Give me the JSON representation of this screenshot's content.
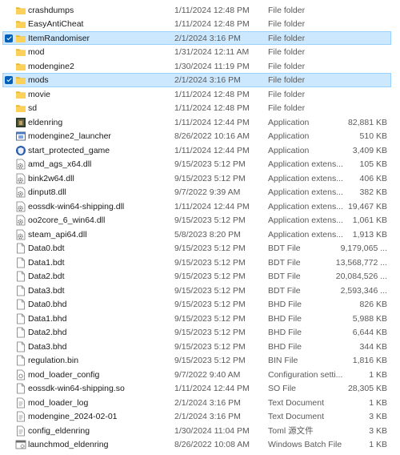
{
  "files": [
    {
      "name": "crashdumps",
      "date": "1/11/2024 12:48 PM",
      "type": "File folder",
      "size": "",
      "icon": "folder-icon",
      "selected": false
    },
    {
      "name": "EasyAntiCheat",
      "date": "1/11/2024 12:48 PM",
      "type": "File folder",
      "size": "",
      "icon": "folder-icon",
      "selected": false
    },
    {
      "name": "ItemRandomiser",
      "date": "2/1/2024 3:16 PM",
      "type": "File folder",
      "size": "",
      "icon": "folder-icon",
      "selected": true
    },
    {
      "name": "mod",
      "date": "1/31/2024 12:11 AM",
      "type": "File folder",
      "size": "",
      "icon": "folder-icon",
      "selected": false
    },
    {
      "name": "modengine2",
      "date": "1/30/2024 11:19 PM",
      "type": "File folder",
      "size": "",
      "icon": "folder-icon",
      "selected": false
    },
    {
      "name": "mods",
      "date": "2/1/2024 3:16 PM",
      "type": "File folder",
      "size": "",
      "icon": "folder-icon",
      "selected": true
    },
    {
      "name": "movie",
      "date": "1/11/2024 12:48 PM",
      "type": "File folder",
      "size": "",
      "icon": "folder-icon",
      "selected": false
    },
    {
      "name": "sd",
      "date": "1/11/2024 12:48 PM",
      "type": "File folder",
      "size": "",
      "icon": "folder-icon",
      "selected": false
    },
    {
      "name": "eldenring",
      "date": "1/11/2024 12:44 PM",
      "type": "Application",
      "size": "82,881 KB",
      "icon": "eldenring-app-icon",
      "selected": false
    },
    {
      "name": "modengine2_launcher",
      "date": "8/26/2022 10:16 AM",
      "type": "Application",
      "size": "510 KB",
      "icon": "application-icon",
      "selected": false
    },
    {
      "name": "start_protected_game",
      "date": "1/11/2024 12:44 PM",
      "type": "Application",
      "size": "3,409 KB",
      "icon": "shield-app-icon",
      "selected": false
    },
    {
      "name": "amd_ags_x64.dll",
      "date": "9/15/2023 5:12 PM",
      "type": "Application extens...",
      "size": "105 KB",
      "icon": "dll-gear-icon",
      "selected": false
    },
    {
      "name": "bink2w64.dll",
      "date": "9/15/2023 5:12 PM",
      "type": "Application extens...",
      "size": "406 KB",
      "icon": "dll-gear-icon",
      "selected": false
    },
    {
      "name": "dinput8.dll",
      "date": "9/7/2022 9:39 AM",
      "type": "Application extens...",
      "size": "382 KB",
      "icon": "dll-gear-icon",
      "selected": false
    },
    {
      "name": "eossdk-win64-shipping.dll",
      "date": "1/11/2024 12:44 PM",
      "type": "Application extens...",
      "size": "19,467 KB",
      "icon": "dll-gear-icon",
      "selected": false
    },
    {
      "name": "oo2core_6_win64.dll",
      "date": "9/15/2023 5:12 PM",
      "type": "Application extens...",
      "size": "1,061 KB",
      "icon": "dll-gear-icon",
      "selected": false
    },
    {
      "name": "steam_api64.dll",
      "date": "5/8/2023 8:20 PM",
      "type": "Application extens...",
      "size": "1,913 KB",
      "icon": "dll-gear-icon",
      "selected": false
    },
    {
      "name": "Data0.bdt",
      "date": "9/15/2023 5:12 PM",
      "type": "BDT File",
      "size": "9,179,065 ...",
      "icon": "file-icon",
      "selected": false
    },
    {
      "name": "Data1.bdt",
      "date": "9/15/2023 5:12 PM",
      "type": "BDT File",
      "size": "13,568,772 ...",
      "icon": "file-icon",
      "selected": false
    },
    {
      "name": "Data2.bdt",
      "date": "9/15/2023 5:12 PM",
      "type": "BDT File",
      "size": "20,084,526 ...",
      "icon": "file-icon",
      "selected": false
    },
    {
      "name": "Data3.bdt",
      "date": "9/15/2023 5:12 PM",
      "type": "BDT File",
      "size": "2,593,346 ...",
      "icon": "file-icon",
      "selected": false
    },
    {
      "name": "Data0.bhd",
      "date": "9/15/2023 5:12 PM",
      "type": "BHD File",
      "size": "826 KB",
      "icon": "file-icon",
      "selected": false
    },
    {
      "name": "Data1.bhd",
      "date": "9/15/2023 5:12 PM",
      "type": "BHD File",
      "size": "5,988 KB",
      "icon": "file-icon",
      "selected": false
    },
    {
      "name": "Data2.bhd",
      "date": "9/15/2023 5:12 PM",
      "type": "BHD File",
      "size": "6,644 KB",
      "icon": "file-icon",
      "selected": false
    },
    {
      "name": "Data3.bhd",
      "date": "9/15/2023 5:12 PM",
      "type": "BHD File",
      "size": "344 KB",
      "icon": "file-icon",
      "selected": false
    },
    {
      "name": "regulation.bin",
      "date": "9/15/2023 5:12 PM",
      "type": "BIN File",
      "size": "1,816 KB",
      "icon": "file-icon",
      "selected": false
    },
    {
      "name": "mod_loader_config",
      "date": "9/7/2022 9:40 AM",
      "type": "Configuration setti...",
      "size": "1 KB",
      "icon": "config-file-icon",
      "selected": false
    },
    {
      "name": "eossdk-win64-shipping.so",
      "date": "1/11/2024 12:44 PM",
      "type": "SO File",
      "size": "28,305 KB",
      "icon": "file-icon",
      "selected": false
    },
    {
      "name": "mod_loader_log",
      "date": "2/1/2024 3:16 PM",
      "type": "Text Document",
      "size": "1 KB",
      "icon": "text-file-icon",
      "selected": false
    },
    {
      "name": "modengine_2024-02-01",
      "date": "2/1/2024 3:16 PM",
      "type": "Text Document",
      "size": "3 KB",
      "icon": "text-file-icon",
      "selected": false
    },
    {
      "name": "config_eldenring",
      "date": "1/30/2024 11:04 PM",
      "type": "Toml 源文件",
      "size": "3 KB",
      "icon": "text-file-icon",
      "selected": false
    },
    {
      "name": "launchmod_eldenring",
      "date": "8/26/2022 10:08 AM",
      "type": "Windows Batch File",
      "size": "1 KB",
      "icon": "batch-file-icon",
      "selected": false
    }
  ]
}
